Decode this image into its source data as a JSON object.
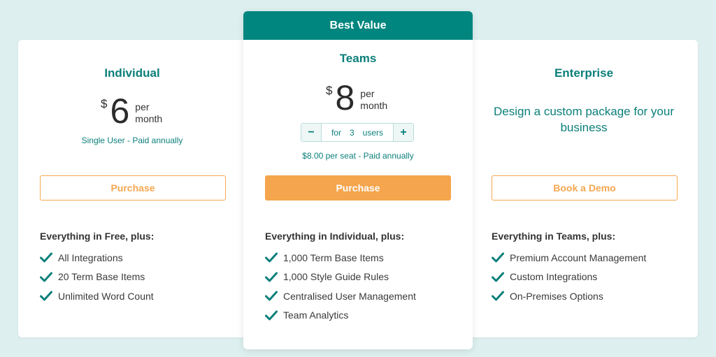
{
  "accent_color": "#0b7f7a",
  "cta_color": "#f5a54d",
  "plans": {
    "individual": {
      "name": "Individual",
      "currency": "$",
      "amount": "6",
      "period_line1": "per",
      "period_line2": "month",
      "note": "Single User - Paid annually",
      "cta": "Purchase",
      "features_heading": "Everything in Free, plus:",
      "features": [
        "All Integrations",
        "20 Term Base Items",
        "Unlimited Word Count"
      ]
    },
    "teams": {
      "badge": "Best Value",
      "name": "Teams",
      "currency": "$",
      "amount": "8",
      "period_line1": "per",
      "period_line2": "month",
      "stepper": {
        "prefix": "for",
        "value": "3",
        "suffix": "users",
        "minus": "−",
        "plus": "+"
      },
      "note": "$8.00 per seat - Paid annually",
      "cta": "Purchase",
      "features_heading": "Everything in Individual, plus:",
      "features": [
        "1,000 Term Base Items",
        "1,000 Style Guide Rules",
        "Centralised User Management",
        "Team Analytics"
      ]
    },
    "enterprise": {
      "name": "Enterprise",
      "description": "Design a custom package for your business",
      "cta": "Book a Demo",
      "features_heading": "Everything in Teams, plus:",
      "features": [
        "Premium Account Management",
        "Custom Integrations",
        "On-Premises Options"
      ]
    }
  },
  "icons": {
    "feature_check": "check-icon"
  }
}
